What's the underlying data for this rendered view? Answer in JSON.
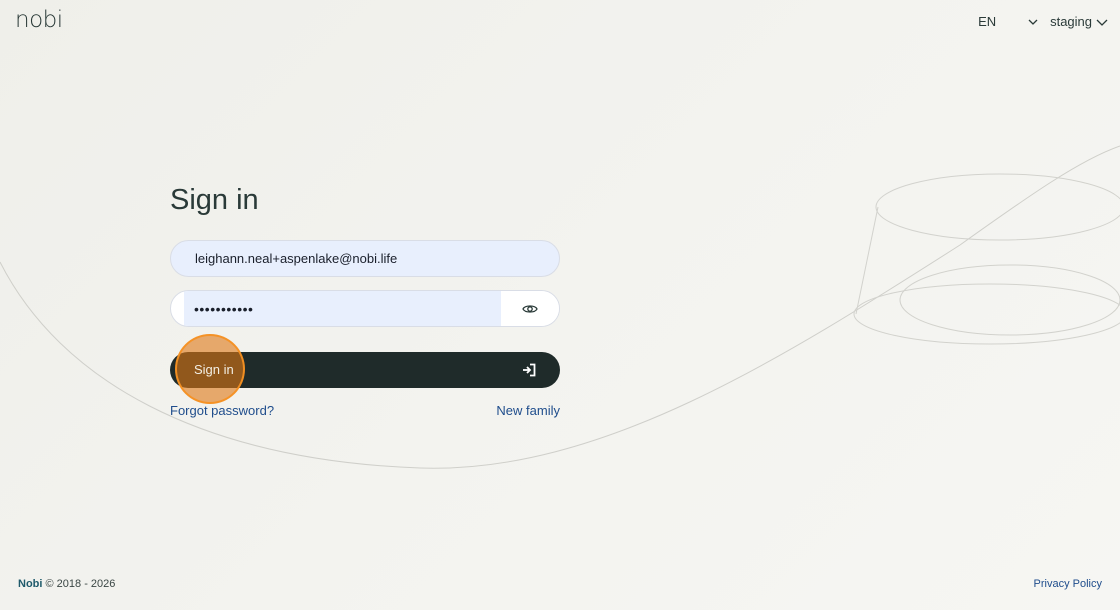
{
  "header": {
    "logo_text": "nobi",
    "language": "EN",
    "environment": "staging"
  },
  "form": {
    "title": "Sign in",
    "email_value": "leighann.neal+aspenlake@nobi.life",
    "password_value": "•••••••••••",
    "submit_label": "Sign in",
    "forgot_password_label": "Forgot password?",
    "new_family_label": "New family"
  },
  "footer": {
    "brand": "Nobi",
    "copyright": " © 2018 - 2026",
    "privacy_label": "Privacy Policy"
  },
  "colors": {
    "button_bg": "#1f2b2a",
    "link": "#1f4d8c",
    "input_bg": "#e8effd",
    "click_highlight": "#de7614"
  }
}
